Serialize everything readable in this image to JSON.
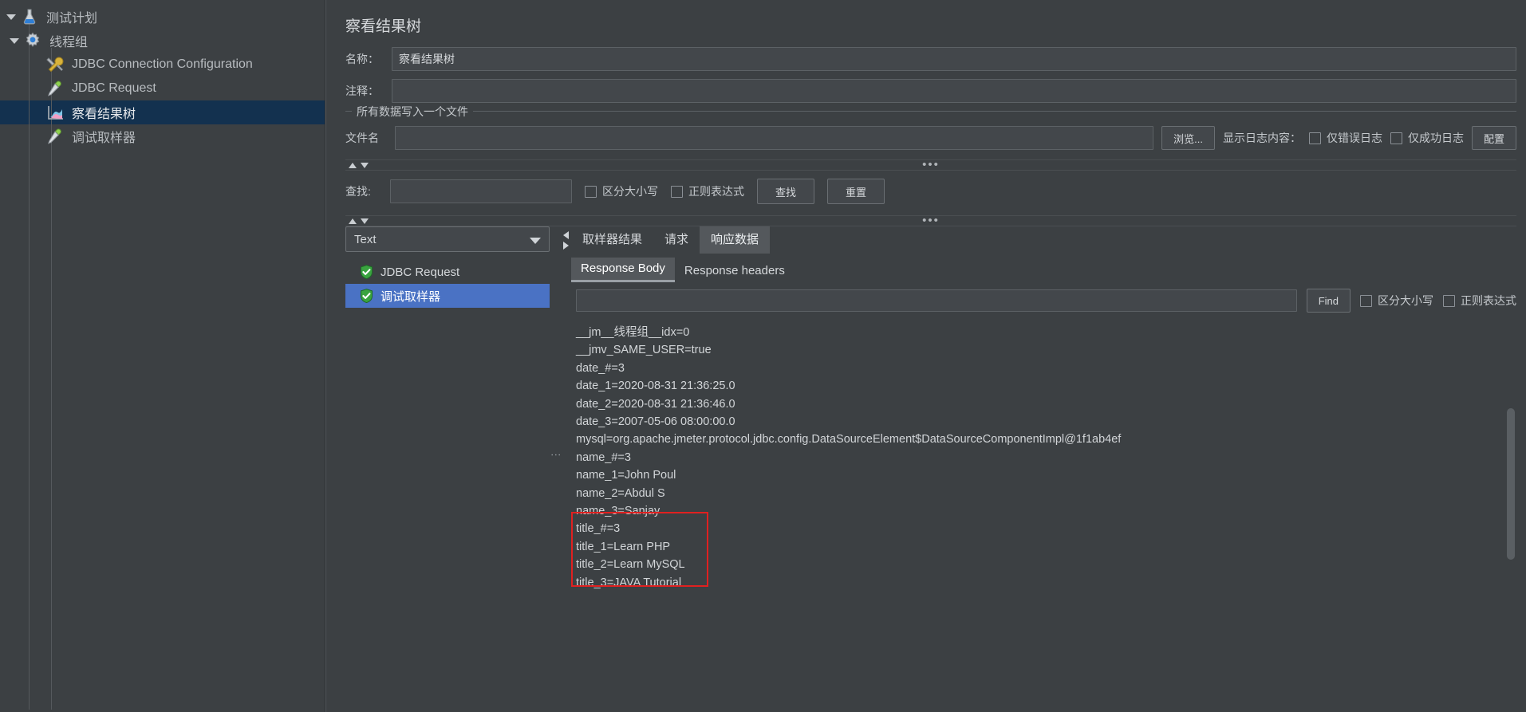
{
  "tree": {
    "items": [
      {
        "label": "测试计划",
        "icon": "flask-icon",
        "depth": 0,
        "expanded": true,
        "selected": false
      },
      {
        "label": "线程组",
        "icon": "gear-icon",
        "depth": 1,
        "expanded": true,
        "selected": false
      },
      {
        "label": "JDBC Connection Configuration",
        "icon": "tools-icon",
        "depth": 2,
        "expanded": false,
        "selected": false
      },
      {
        "label": "JDBC Request",
        "icon": "pipette-icon",
        "depth": 2,
        "expanded": false,
        "selected": false
      },
      {
        "label": "察看结果树",
        "icon": "chart-icon",
        "depth": 2,
        "expanded": false,
        "selected": true
      },
      {
        "label": "调试取样器",
        "icon": "pipette-icon",
        "depth": 2,
        "expanded": false,
        "selected": false
      }
    ]
  },
  "panel": {
    "title": "察看结果树",
    "name_label": "名称：",
    "name_value": "察看结果树",
    "comment_label": "注释：",
    "comment_value": ""
  },
  "file_group": {
    "legend": "所有数据写入一个文件",
    "filename_label": "文件名",
    "filename_value": "",
    "browse_button": "浏览...",
    "log_display_label": "显示日志内容：",
    "errors_only_label": "仅错误日志",
    "successes_only_label": "仅成功日志",
    "configure_button": "配置"
  },
  "search": {
    "label": "查找:",
    "value": "",
    "case_sensitive_label": "区分大小写",
    "regex_label": "正则表达式",
    "find_button": "查找",
    "reset_button": "重置"
  },
  "results": {
    "renderer_selected": "Text",
    "items": [
      {
        "label": "JDBC Request",
        "status": "success",
        "selected": false
      },
      {
        "label": "调试取样器",
        "status": "success",
        "selected": true
      }
    ]
  },
  "detail": {
    "tabs": [
      {
        "label": "取样器结果",
        "active": false
      },
      {
        "label": "请求",
        "active": false
      },
      {
        "label": "响应数据",
        "active": true
      }
    ],
    "subtabs": [
      {
        "label": "Response Body",
        "active": true
      },
      {
        "label": "Response headers",
        "active": false
      }
    ],
    "find_value": "",
    "find_button": "Find",
    "case_sensitive_label": "区分大小写",
    "regex_label": "正则表达式",
    "response_lines": [
      "__jm__线程组__idx=0",
      "__jmv_SAME_USER=true",
      "date_#=3",
      "date_1=2020-08-31 21:36:25.0",
      "date_2=2020-08-31 21:36:46.0",
      "date_3=2007-05-06 08:00:00.0",
      "mysql=org.apache.jmeter.protocol.jdbc.config.DataSourceElement$DataSourceComponentImpl@1f1ab4ef",
      "name_#=3",
      "name_1=John Poul",
      "name_2=Abdul S",
      "name_3=Sanjay",
      "title_#=3",
      "title_1=Learn PHP",
      "title_2=Learn MySQL",
      "title_3=JAVA Tutorial"
    ]
  },
  "colors": {
    "selection_blue": "#4a72c4",
    "tree_selection": "#13314f",
    "highlight_red": "#e02020",
    "background": "#3c4043"
  }
}
